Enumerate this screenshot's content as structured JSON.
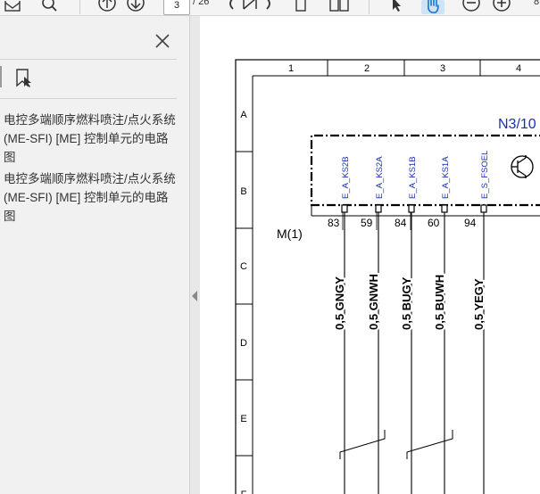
{
  "toolbar": {
    "current_page": "3",
    "page_total": "/ 26",
    "zoom_partial": "8"
  },
  "sidebar": {
    "bookmarks": [
      {
        "label": "电控多端顺序燃料喷注/点火系统 (ME-SFI) [ME] 控制单元的电路图"
      },
      {
        "label": "电控多端顺序燃料喷注/点火系统 (ME-SFI) [ME] 控制单元的电路图"
      }
    ]
  },
  "diagram": {
    "col_labels": [
      "1",
      "2",
      "3",
      "4"
    ],
    "row_labels": [
      "A",
      "B",
      "C",
      "D",
      "E",
      "F"
    ],
    "module_label": "N3/10",
    "connector_label": "M(1)",
    "pins": [
      {
        "signal": "E_A_KS2B",
        "number": "83",
        "wire": "0,5 GNGY"
      },
      {
        "signal": "E_A_KS2A",
        "number": "59",
        "wire": "0,5 GNWH"
      },
      {
        "signal": "E_A_KS1B",
        "number": "84",
        "wire": "0,5 BUGY"
      },
      {
        "signal": "E_A_KS1A",
        "number": "60",
        "wire": "0,5 BUWH"
      },
      {
        "signal": "E_S_FSOEL",
        "number": "94",
        "wire": "0,5 YEGY"
      }
    ]
  }
}
